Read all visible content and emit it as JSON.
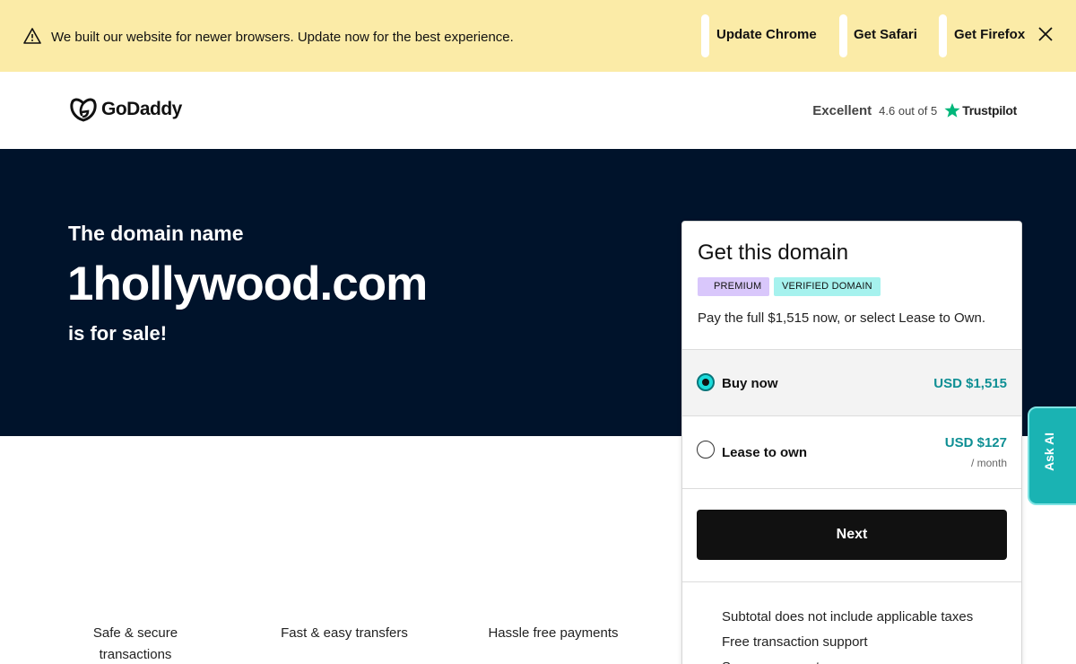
{
  "banner": {
    "message": "We built our website for newer browsers. Update now for the best experience.",
    "links": [
      "Update Chrome",
      "Get Safari",
      "Get Firefox"
    ],
    "warning_icon": "warning-triangle-icon",
    "close_icon": "close-icon"
  },
  "header": {
    "logo_text": "GoDaddy",
    "rating": {
      "label": "Excellent",
      "score": "4.6 out of 5",
      "provider": "Trustpilot"
    }
  },
  "hero": {
    "kicker": "The domain name",
    "domain": "1hollywood.com",
    "status": "is for sale!"
  },
  "features": [
    "Safe & secure transactions",
    "Fast & easy transfers",
    "Hassle free payments"
  ],
  "card": {
    "title": "Get this domain",
    "badges": [
      "PREMIUM",
      "VERIFIED DOMAIN"
    ],
    "intro": "Pay the full $1,515 now, or select Lease to Own.",
    "options": [
      {
        "label": "Buy now",
        "price": "USD $1,515",
        "per": "",
        "selected": true
      },
      {
        "label": "Lease to own",
        "price": "USD $127",
        "per": "/ month",
        "selected": false
      }
    ],
    "next_label": "Next",
    "perks": [
      "Subtotal does not include applicable taxes",
      "Free transaction support",
      "Secure payments"
    ]
  },
  "ask_ai": "Ask AI",
  "colors": {
    "banner_bg": "#fbeba7",
    "hero_bg": "#00132b",
    "accent_teal": "#0e8f94",
    "premium_badge": "#d9c7fb",
    "verified_badge": "#a6f2ee",
    "trustpilot_green": "#00b67a",
    "ask_ai_bg": "#1ab3b3"
  }
}
